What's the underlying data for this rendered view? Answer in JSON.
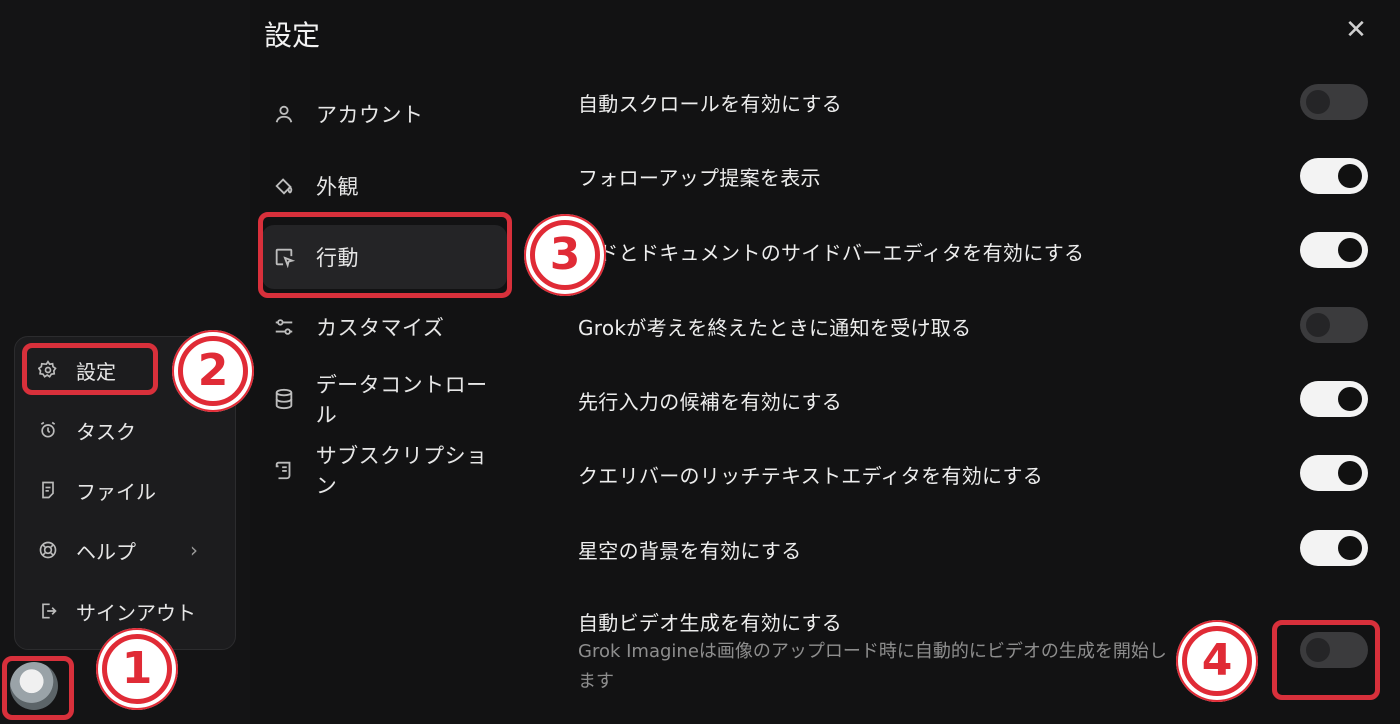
{
  "title": "設定",
  "close_label": "✕",
  "nav": [
    {
      "label": "アカウント",
      "icon": "user-icon"
    },
    {
      "label": "外観",
      "icon": "paint-bucket-icon"
    },
    {
      "label": "行動",
      "icon": "cursor-box-icon"
    },
    {
      "label": "カスタマイズ",
      "icon": "sliders-icon"
    },
    {
      "label": "データコントロール",
      "icon": "database-icon"
    },
    {
      "label": "サブスクリプション",
      "icon": "scroll-icon"
    }
  ],
  "settings": [
    {
      "label": "自動スクロールを有効にする",
      "on": false
    },
    {
      "label": "フォローアップ提案を表示",
      "on": true
    },
    {
      "label": "ードとドキュメントのサイドバーエディタを有効にする",
      "on": true
    },
    {
      "label": "Grokが考えを終えたときに通知を受け取る",
      "on": false
    },
    {
      "label": "先行入力の候補を有効にする",
      "on": true
    },
    {
      "label": "クエリバーのリッチテキストエディタを有効にする",
      "on": true
    },
    {
      "label": "星空の背景を有効にする",
      "on": true
    },
    {
      "label": "自動ビデオ生成を有効にする",
      "desc": "Grok Imagineは画像のアップロード時に自動的にビデオの生成を開始します",
      "on": false
    }
  ],
  "menu": [
    {
      "label": "設定",
      "icon": "gear-icon"
    },
    {
      "label": "タスク",
      "icon": "alarm-icon"
    },
    {
      "label": "ファイル",
      "icon": "file-icon"
    },
    {
      "label": "ヘルプ",
      "icon": "lifebuoy-icon",
      "chevron": "›"
    },
    {
      "label": "サインアウト",
      "icon": "sign-out-icon"
    }
  ],
  "badges": [
    "①",
    "②",
    "③",
    "④"
  ],
  "colors": {
    "accent_red": "#d8303b",
    "toggle_on": "#f3f3f3",
    "toggle_off": "#3b3b3d"
  }
}
